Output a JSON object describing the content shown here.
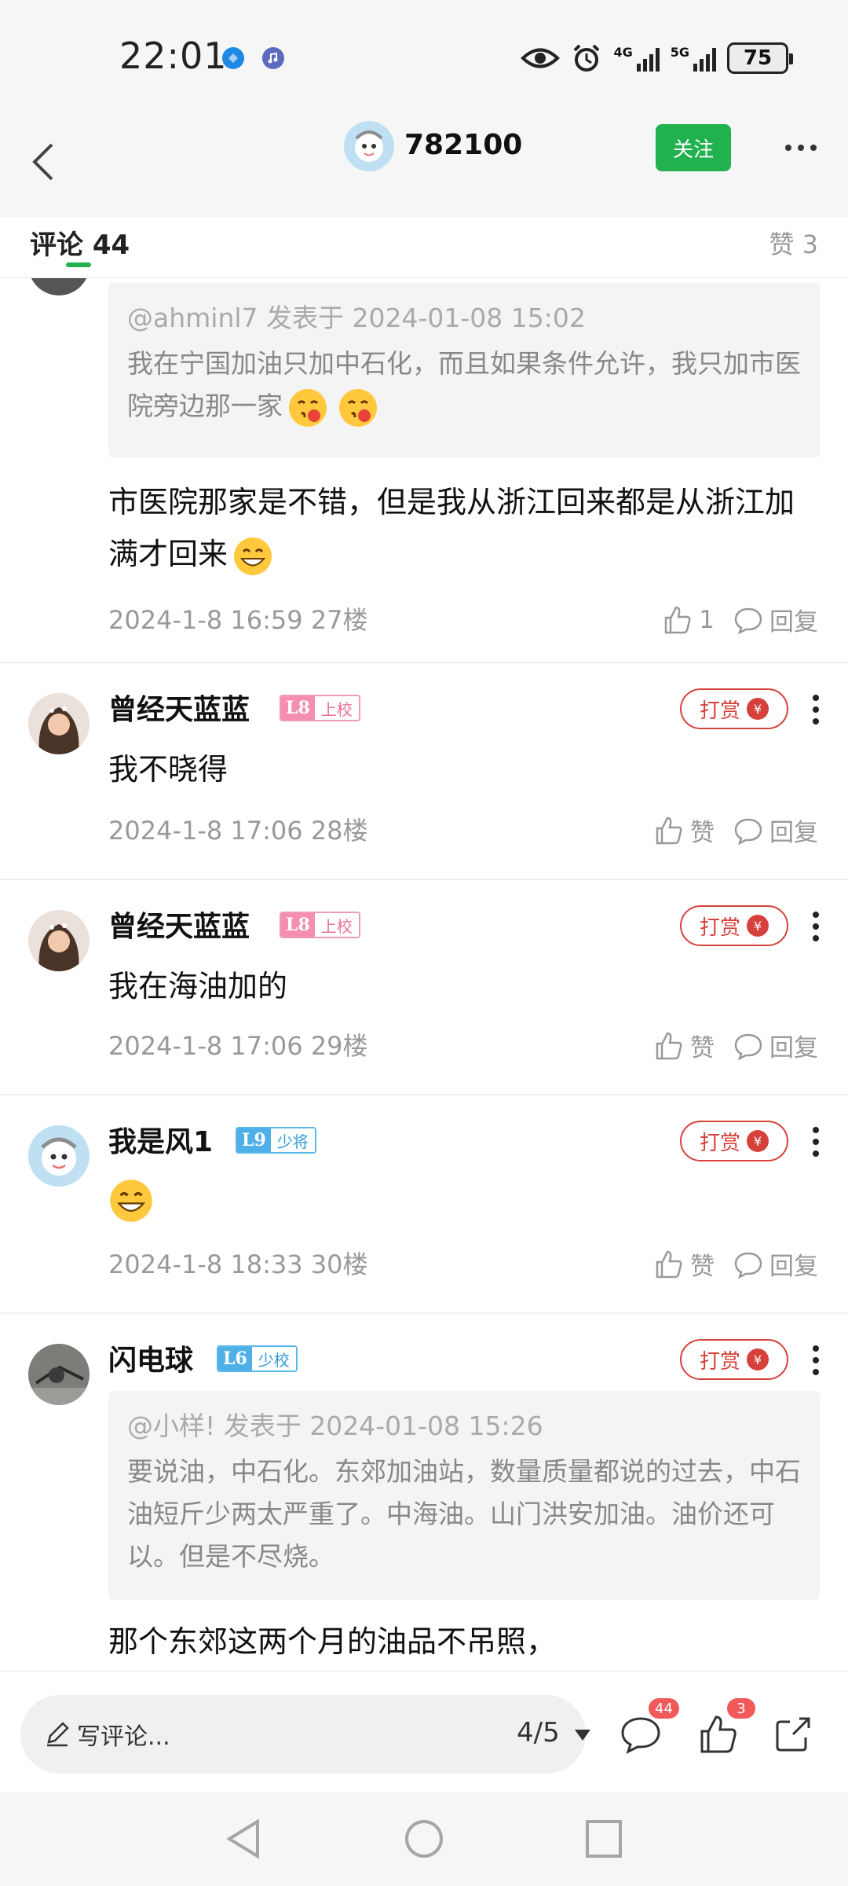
{
  "status_bar": {
    "time": "22:01",
    "network_1": "4G",
    "network_2": "5G",
    "battery": "75",
    "icons": [
      "eye-icon",
      "alarm-icon",
      "signal-icon",
      "battery-icon"
    ]
  },
  "header": {
    "title": "782100",
    "follow_label": "关注"
  },
  "tabs": {
    "comments_label": "评论 44",
    "likes_label": "赞 3"
  },
  "comments": [
    {
      "quote_head": "@ahminl7 发表于 2024-01-08 15:02",
      "quote_text": "我在宁国加油只加中石化，而且如果条件允许，我只加市医院旁边那一家",
      "text": "市医院那家是不错，但是我从浙江回来都是从浙江加满才回来",
      "meta": "2024-1-8 16:59  27楼",
      "like_label": "1",
      "reply_label": "回复"
    },
    {
      "user": "曾经天蓝蓝",
      "level": "L8",
      "rank": "上校",
      "tip_label": "打赏",
      "text": "我不晓得",
      "meta": "2024-1-8 17:06  28楼",
      "like_label": "赞",
      "reply_label": "回复"
    },
    {
      "user": "曾经天蓝蓝",
      "level": "L8",
      "rank": "上校",
      "tip_label": "打赏",
      "text": "我在海油加的",
      "meta": "2024-1-8 17:06  29楼",
      "like_label": "赞",
      "reply_label": "回复"
    },
    {
      "user": "我是风1",
      "level": "L9",
      "rank": "少将",
      "tip_label": "打赏",
      "text": "",
      "meta": "2024-1-8 18:33  30楼",
      "like_label": "赞",
      "reply_label": "回复"
    },
    {
      "user": "闪电球",
      "level": "L6",
      "rank": "少校",
      "tip_label": "打赏",
      "quote_head": "@小样!   发表于 2024-01-08 15:26",
      "quote_text": "要说油，中石化。东郊加油站，数量质量都说的过去，中石油短斤少两太严重了。中海油。山门洪安加油。油价还可以。但是不尽烧。",
      "text": "那个东郊这两个月的油品不吊照，"
    }
  ],
  "bottom_bar": {
    "write_placeholder": "写评论...",
    "pager": "4/5",
    "comment_count": "44",
    "like_count": "3"
  },
  "colors": {
    "accent_green": "#21b14f",
    "tip_red": "#d6413b",
    "badge_red": "#f05a5a"
  }
}
